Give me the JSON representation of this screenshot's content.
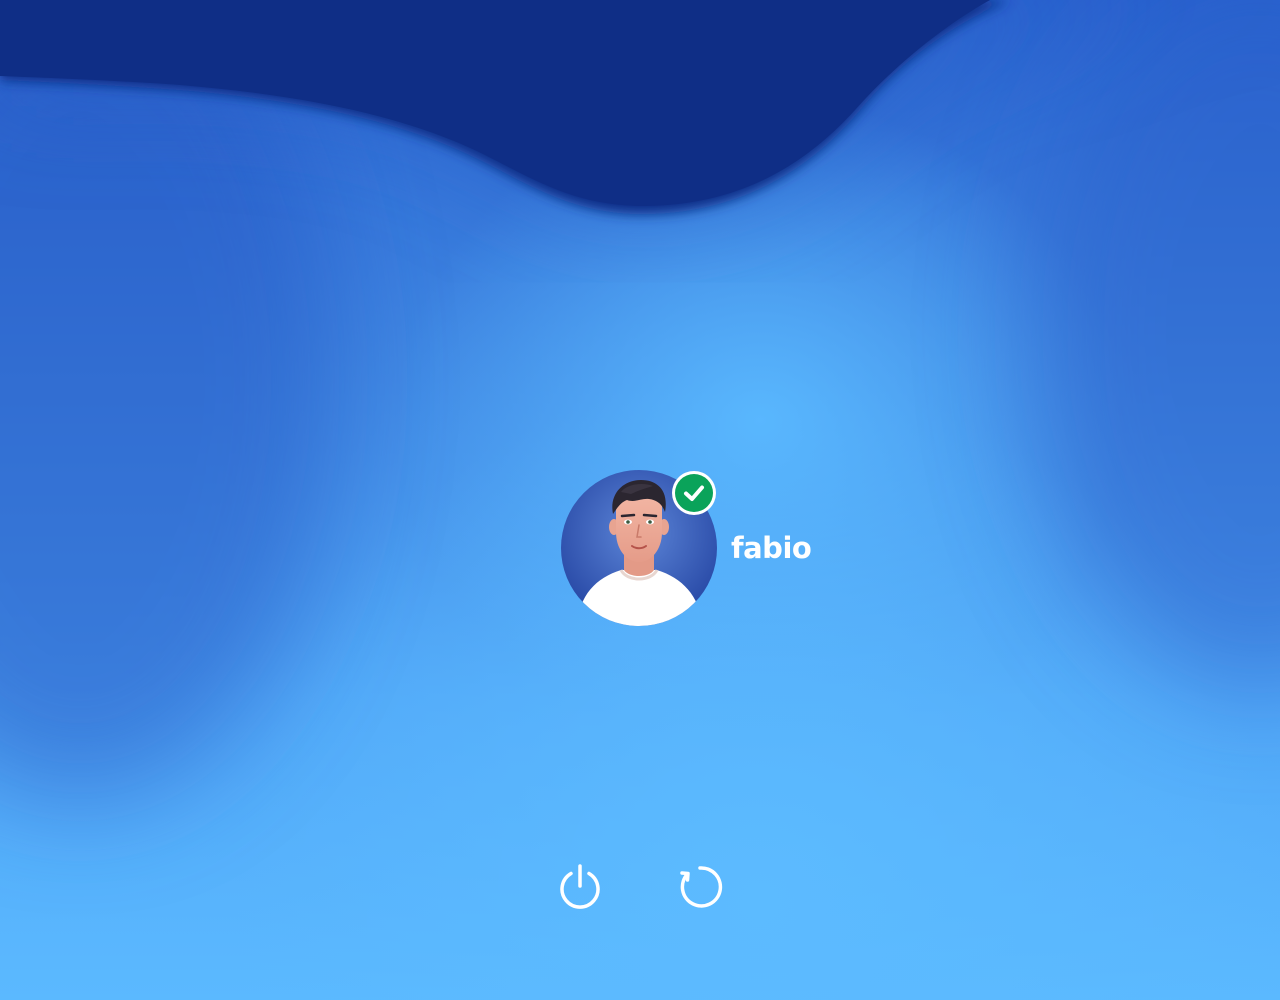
{
  "user": {
    "name": "fabio",
    "avatar": "man-portrait-avatar",
    "status": "verified",
    "status_icon": "checkmark-icon",
    "status_color": "#0aa35a"
  },
  "controls": {
    "shutdown": {
      "icon": "power-icon"
    },
    "restart": {
      "icon": "restart-icon"
    }
  },
  "colors": {
    "background_top": "#0f2f88",
    "background_mid": "#3f86e2",
    "background_bottom": "#5bb9ff",
    "text": "#ffffff"
  }
}
